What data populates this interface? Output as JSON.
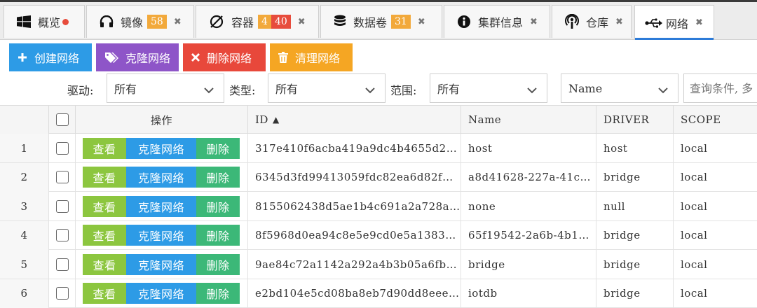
{
  "tabs": [
    {
      "name": "tab-overview",
      "label": "概览",
      "icon": "windows-icon"
    },
    {
      "name": "tab-images",
      "label": "镜像",
      "badges": [
        "58"
      ],
      "icon": "headphones-icon"
    },
    {
      "name": "tab-containers",
      "label": "容器",
      "badges": [
        "4",
        "40"
      ],
      "icon": "circle-slash-icon"
    },
    {
      "name": "tab-volumes",
      "label": "数据卷",
      "badges": [
        "31"
      ],
      "icon": "database-icon"
    },
    {
      "name": "tab-cluster",
      "label": "集群信息",
      "icon": "info-icon"
    },
    {
      "name": "tab-repository",
      "label": "仓库",
      "icon": "podcast-icon"
    },
    {
      "name": "tab-network",
      "label": "网络",
      "icon": "usb-icon",
      "active": true
    }
  ],
  "close_glyph": "✖",
  "colors": {
    "blue": "#2d9be6",
    "purple": "#8e55c8",
    "red": "#e8483b",
    "orange": "#f5a623",
    "green": "#8cc63f",
    "teal": "#3cb878"
  },
  "toolbar": {
    "create": "创建网络",
    "clone": "克隆网络",
    "delete": "删除网络",
    "clean": "清理网络"
  },
  "filters": {
    "driver_label": "驱动:",
    "driver_value": "所有",
    "type_label": "类型:",
    "type_value": "所有",
    "scope_label": "范围:",
    "scope_value": "所有",
    "field_value": "Name",
    "query_placeholder": "查询条件, 多"
  },
  "table": {
    "headers": {
      "ops": "操作",
      "id": "ID",
      "name": "Name",
      "driver": "DRIVER",
      "scope": "SCOPE"
    },
    "sort_indicator": "▲",
    "op_labels": {
      "view": "查看",
      "clone": "克隆网络",
      "delete": "删除"
    },
    "rows": [
      {
        "num": "1",
        "id": "317e410f6acba419a9dc4b4655d2…",
        "name": "host",
        "driver": "host",
        "scope": "local"
      },
      {
        "num": "2",
        "id": "6345d3fd99413059fdc82ea6d82f…",
        "name": "a8d41628-227a-41c…",
        "driver": "bridge",
        "scope": "local"
      },
      {
        "num": "3",
        "id": "8155062438d5ae1b4c691a2a728a…",
        "name": "none",
        "driver": "null",
        "scope": "local"
      },
      {
        "num": "4",
        "id": "8f5968d0ea94c8e5e9cd0e5a1383…",
        "name": "65f19542-2a6b-4b1…",
        "driver": "bridge",
        "scope": "local"
      },
      {
        "num": "5",
        "id": "9ae84c72a1142a292a4b3b05a6fb…",
        "name": "bridge",
        "driver": "bridge",
        "scope": "local"
      },
      {
        "num": "6",
        "id": "e2bd104e5cd08ba8eb7d90dd8eee…",
        "name": "iotdb",
        "driver": "bridge",
        "scope": "local"
      }
    ]
  }
}
